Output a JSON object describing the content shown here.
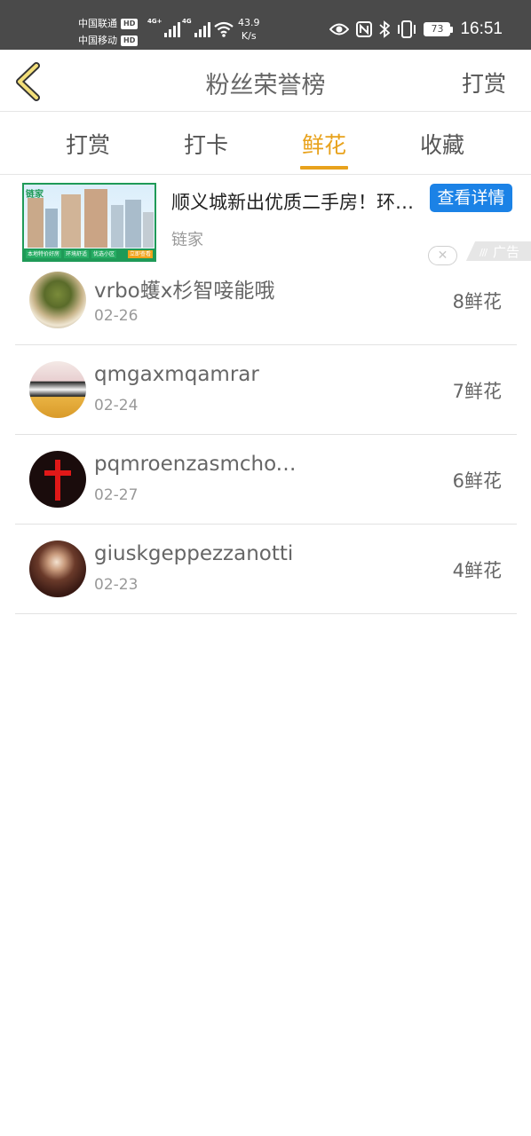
{
  "status_bar": {
    "carrier1": "中国联通",
    "carrier2": "中国移动",
    "hd": "HD",
    "net1": "4G+",
    "net2": "4G",
    "speed_value": "43.9",
    "speed_unit": "K/s",
    "battery": "73",
    "time": "16:51"
  },
  "nav": {
    "title": "粉丝荣誉榜",
    "action": "打赏"
  },
  "tabs": [
    {
      "label": "打赏",
      "active": false
    },
    {
      "label": "打卡",
      "active": false
    },
    {
      "label": "鲜花",
      "active": true
    },
    {
      "label": "收藏",
      "active": false
    }
  ],
  "ad": {
    "title": "顺义城新出优质二手房！环境好",
    "button": "查看详情",
    "source": "链家",
    "badge": "广告",
    "image_logo": "链家",
    "image_tags": [
      "本地特价好房",
      "环境舒适",
      "优选小区",
      "立即查看"
    ]
  },
  "list": [
    {
      "name": "vrbo蠖x杉智唼能哦",
      "date": "02-26",
      "count": "8鲜花"
    },
    {
      "name": "qmgaxmqamrar",
      "date": "02-24",
      "count": "7鲜花"
    },
    {
      "name": "pqmroenzasmchoxyz",
      "date": "02-27",
      "count": "6鲜花"
    },
    {
      "name": "giuskgeppezzanotti",
      "date": "02-23",
      "count": "4鲜花"
    }
  ],
  "colors": {
    "accent": "#e8a21c",
    "status_bar": "#4a4a4a",
    "ad_button": "#1b82e6",
    "ad_border": "#1f9a57"
  }
}
